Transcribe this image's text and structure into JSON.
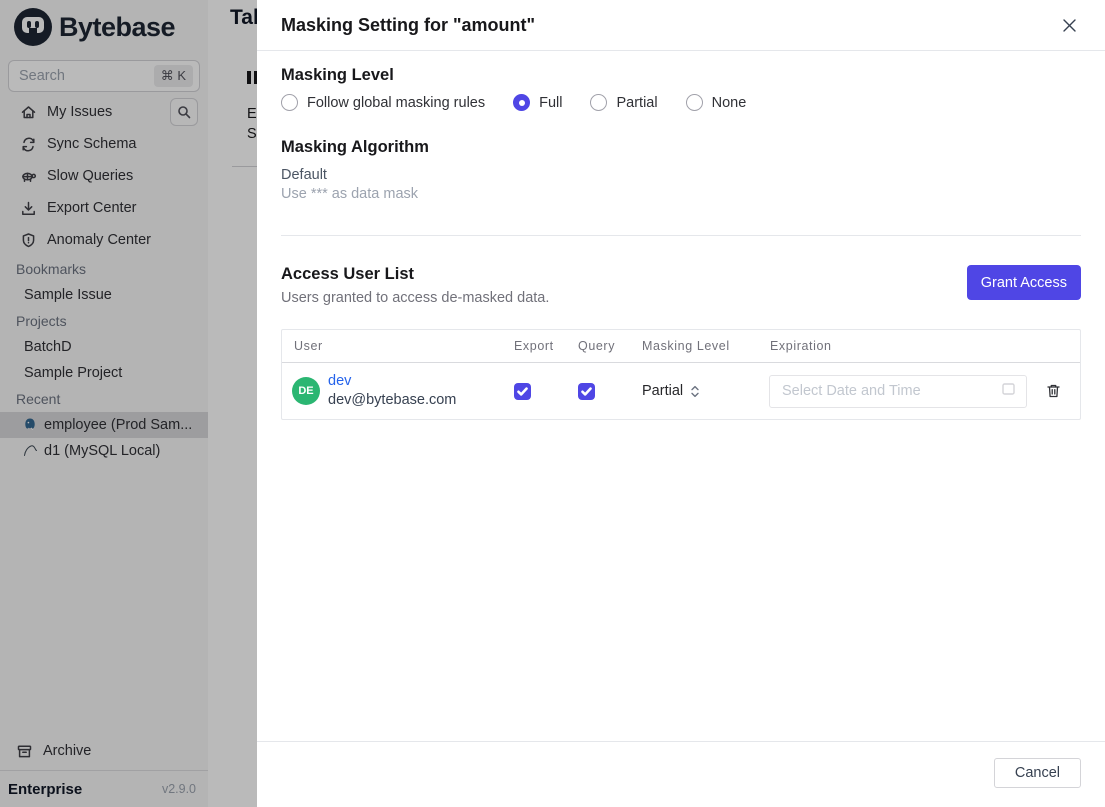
{
  "sidebar": {
    "logo_text": "Bytebase",
    "search": {
      "placeholder": "Search",
      "shortcut": "⌘ K"
    },
    "nav": [
      {
        "label": "My Issues",
        "icon": "home-icon"
      },
      {
        "label": "Sync Schema",
        "icon": "sync-icon"
      },
      {
        "label": "Slow Queries",
        "icon": "turtle-icon"
      },
      {
        "label": "Export Center",
        "icon": "download-icon"
      },
      {
        "label": "Anomaly Center",
        "icon": "shield-icon"
      }
    ],
    "sections": {
      "bookmarks": {
        "label": "Bookmarks",
        "items": [
          {
            "label": "Sample Issue"
          }
        ]
      },
      "projects": {
        "label": "Projects",
        "items": [
          {
            "label": "BatchD"
          },
          {
            "label": "Sample Project"
          }
        ]
      },
      "recent": {
        "label": "Recent",
        "items": [
          {
            "label": "employee (Prod Sam...",
            "icon": "postgres-icon",
            "selected": true
          },
          {
            "label": "d1 (MySQL Local)",
            "icon": "mysql-icon",
            "selected": false
          }
        ]
      }
    },
    "archive_label": "Archive",
    "plan": "Enterprise",
    "version": "v2.9.0"
  },
  "background_page": {
    "clipped_title": "Tab",
    "clipped_labels": [
      "E",
      "S"
    ]
  },
  "modal": {
    "title": "Masking Setting for \"amount\"",
    "masking_level": {
      "heading": "Masking Level",
      "selected": "Full",
      "options": [
        {
          "label": "Follow global masking rules",
          "selected": false
        },
        {
          "label": "Full",
          "selected": true
        },
        {
          "label": "Partial",
          "selected": false
        },
        {
          "label": "None",
          "selected": false
        }
      ]
    },
    "masking_algorithm": {
      "heading": "Masking Algorithm",
      "name": "Default",
      "description": "Use *** as data mask"
    },
    "access": {
      "heading": "Access User List",
      "subtitle": "Users granted to access de-masked data.",
      "grant_label": "Grant Access"
    },
    "table": {
      "columns": [
        "User",
        "Export",
        "Query",
        "Masking Level",
        "Expiration"
      ],
      "rows": [
        {
          "initials": "DE",
          "name": "dev",
          "email": "dev@bytebase.com",
          "export_checked": true,
          "query_checked": true,
          "masking_level": "Partial",
          "expiration_placeholder": "Select Date and Time"
        }
      ]
    },
    "footer": {
      "cancel_label": "Cancel"
    }
  },
  "colors": {
    "accent_indigo": "#4f46e5",
    "avatar_green": "#2bb672",
    "link_blue": "#2563eb",
    "logo_navy": "#1d2633"
  }
}
